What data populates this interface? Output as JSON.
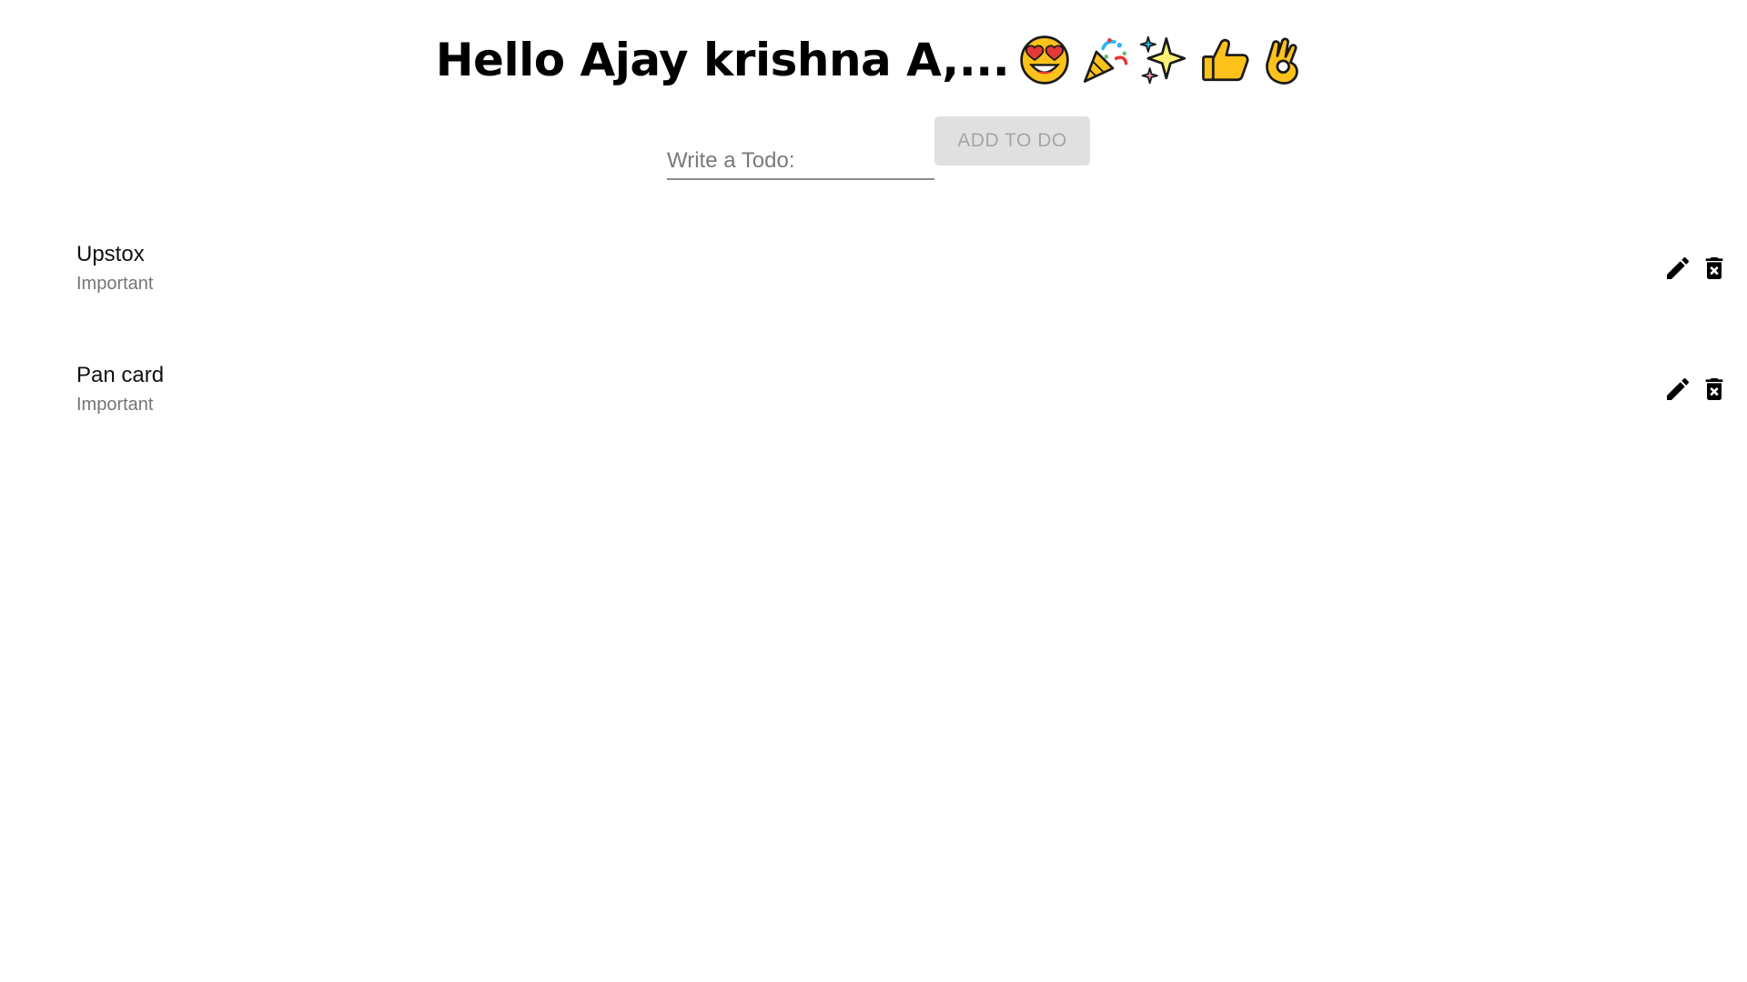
{
  "header": {
    "greeting": "Hello Ajay krishna A,...",
    "emojis": [
      "heart-eyes-face",
      "party-popper",
      "sparkles",
      "thumbs-up",
      "ok-hand"
    ]
  },
  "form": {
    "placeholder": "Write a Todo:",
    "value": "",
    "add_label": "ADD TO DO",
    "add_disabled": true
  },
  "todos": [
    {
      "title": "Upstox",
      "tag": "Important"
    },
    {
      "title": "Pan card",
      "tag": "Important"
    }
  ],
  "colors": {
    "button_bg": "#e0e0e0",
    "button_text": "#a6a6a6",
    "secondary_text": "#757575"
  }
}
